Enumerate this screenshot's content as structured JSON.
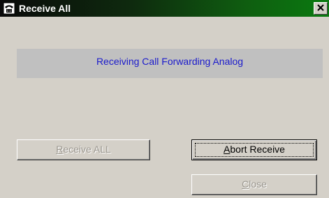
{
  "window": {
    "title": "Receive All",
    "title_icon": "telephone-icon",
    "close_icon": "close-icon",
    "close_glyph": "✕"
  },
  "status": {
    "message": "Receiving Call Forwarding Analog"
  },
  "buttons": {
    "receive_all": {
      "label": "Receive ALL",
      "mnemonic": "R",
      "rest": "eceive ALL",
      "enabled": false
    },
    "abort_receive": {
      "label": "Abort Receive",
      "mnemonic": "A",
      "rest": "bort Receive",
      "enabled": true,
      "default": true
    },
    "close": {
      "label": "Close",
      "mnemonic": "C",
      "rest": "lose",
      "enabled": false
    }
  },
  "colors": {
    "titlebar_start": "#0a0a0a",
    "titlebar_end": "#0a7a10",
    "status_text": "#1a1acc",
    "status_panel": "#c0c0c0",
    "window_bg": "#d4d0c8"
  }
}
